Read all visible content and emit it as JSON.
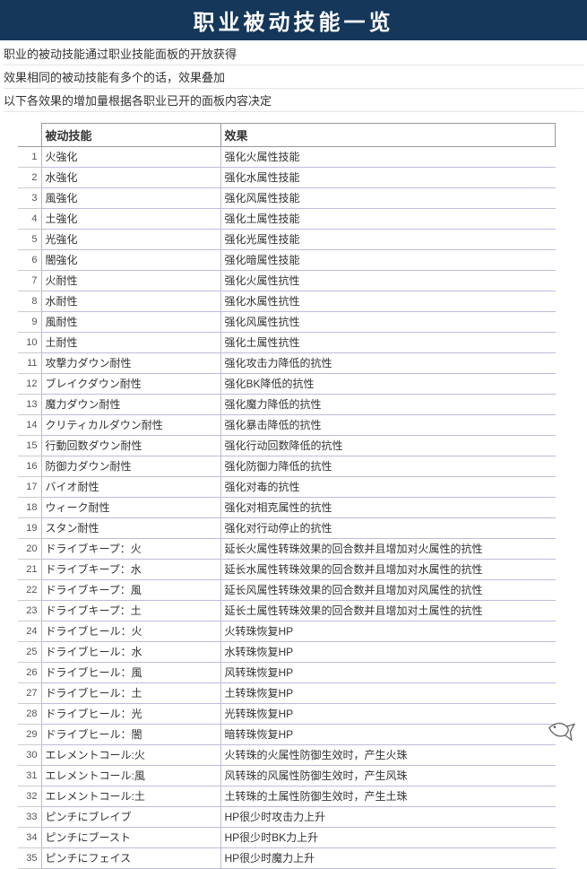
{
  "title": "职业被动技能一览",
  "intro": [
    "职业的被动技能通过职业技能面板的开放获得",
    "效果相同的被动技能有多个的话，效果叠加",
    "以下各效果的增加量根据各职业已开的面板内容决定"
  ],
  "headers": {
    "index": "",
    "skill": "被动技能",
    "effect": "效果"
  },
  "rows": [
    {
      "n": 1,
      "skill": "火強化",
      "effect": "强化火属性技能"
    },
    {
      "n": 2,
      "skill": "水強化",
      "effect": "强化水属性技能"
    },
    {
      "n": 3,
      "skill": "風強化",
      "effect": "强化风属性技能"
    },
    {
      "n": 4,
      "skill": "土強化",
      "effect": "强化土属性技能"
    },
    {
      "n": 5,
      "skill": "光強化",
      "effect": "强化光属性技能"
    },
    {
      "n": 6,
      "skill": "闇強化",
      "effect": "强化暗属性技能"
    },
    {
      "n": 7,
      "skill": "火耐性",
      "effect": "强化火属性抗性"
    },
    {
      "n": 8,
      "skill": "水耐性",
      "effect": "强化水属性抗性"
    },
    {
      "n": 9,
      "skill": "風耐性",
      "effect": "强化风属性抗性"
    },
    {
      "n": 10,
      "skill": "土耐性",
      "effect": "强化土属性抗性"
    },
    {
      "n": 11,
      "skill": "攻撃力ダウン耐性",
      "effect": "强化攻击力降低的抗性"
    },
    {
      "n": 12,
      "skill": "ブレイクダウン耐性",
      "effect": "强化BK降低的抗性"
    },
    {
      "n": 13,
      "skill": "魔力ダウン耐性",
      "effect": "强化魔力降低的抗性"
    },
    {
      "n": 14,
      "skill": "クリティカルダウン耐性",
      "effect": "强化暴击降低的抗性"
    },
    {
      "n": 15,
      "skill": "行動回数ダウン耐性",
      "effect": "强化行动回数降低的抗性"
    },
    {
      "n": 16,
      "skill": "防御力ダウン耐性",
      "effect": "强化防御力降低的抗性"
    },
    {
      "n": 17,
      "skill": "バイオ耐性",
      "effect": "强化对毒的抗性"
    },
    {
      "n": 18,
      "skill": "ウィーク耐性",
      "effect": "强化对相克属性的抗性"
    },
    {
      "n": 19,
      "skill": "スタン耐性",
      "effect": "强化对行动停止的抗性"
    },
    {
      "n": 20,
      "skill": "ドライブキープ：火",
      "effect": "延长火属性转珠效果的回合数并且增加对火属性的抗性"
    },
    {
      "n": 21,
      "skill": "ドライブキープ：水",
      "effect": "延长水属性转珠效果的回合数并且增加对水属性的抗性"
    },
    {
      "n": 22,
      "skill": "ドライブキープ：風",
      "effect": "延长风属性转珠效果的回合数并且增加对风属性的抗性"
    },
    {
      "n": 23,
      "skill": "ドライブキープ：土",
      "effect": "延长土属性转珠效果的回合数并且增加对土属性的抗性"
    },
    {
      "n": 24,
      "skill": "ドライブヒール：火",
      "effect": "火转珠恢复HP"
    },
    {
      "n": 25,
      "skill": "ドライブヒール：水",
      "effect": "水转珠恢复HP"
    },
    {
      "n": 26,
      "skill": "ドライブヒール：風",
      "effect": "风转珠恢复HP"
    },
    {
      "n": 27,
      "skill": "ドライブヒール：土",
      "effect": "土转珠恢复HP"
    },
    {
      "n": 28,
      "skill": "ドライブヒール：光",
      "effect": "光转珠恢复HP"
    },
    {
      "n": 29,
      "skill": "ドライブヒール：闇",
      "effect": "暗转珠恢复HP"
    },
    {
      "n": 30,
      "skill": "エレメントコール:火",
      "effect": "火转珠的火属性防御生效时，产生火珠"
    },
    {
      "n": 31,
      "skill": "エレメントコール:風",
      "effect": "风转珠的风属性防御生效时，产生风珠"
    },
    {
      "n": 32,
      "skill": "エレメントコール:土",
      "effect": "土转珠的土属性防御生效时，产生土珠"
    },
    {
      "n": 33,
      "skill": "ピンチにブレイブ",
      "effect": "HP很少时攻击力上升"
    },
    {
      "n": 34,
      "skill": "ピンチにブースト",
      "effect": "HP很少时BK力上升"
    },
    {
      "n": 35,
      "skill": "ピンチにフェイス",
      "effect": "HP很少时魔力上升"
    }
  ]
}
